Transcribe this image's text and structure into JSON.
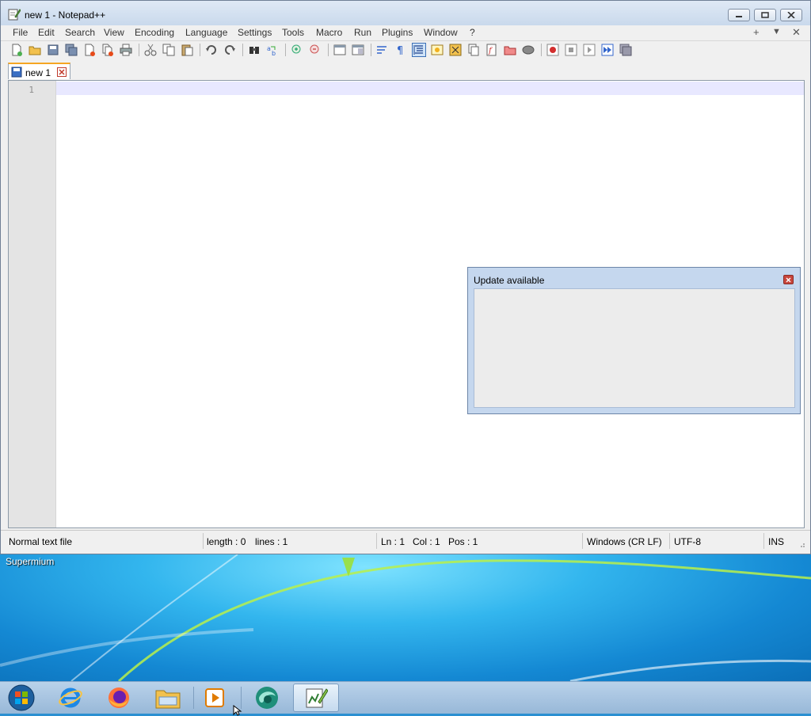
{
  "window": {
    "title": "new 1 - Notepad++"
  },
  "menu": {
    "items": [
      "File",
      "Edit",
      "Search",
      "View",
      "Encoding",
      "Language",
      "Settings",
      "Tools",
      "Macro",
      "Run",
      "Plugins",
      "Window",
      "?"
    ],
    "right_plus": "+",
    "right_down": "▼",
    "right_close": "✕"
  },
  "tabs": [
    {
      "label": "new 1"
    }
  ],
  "editor": {
    "line_number": "1"
  },
  "status": {
    "file_type": "Normal text file",
    "length": "length : 0",
    "lines": "lines : 1",
    "ln": "Ln : 1",
    "col": "Col : 1",
    "pos": "Pos : 1",
    "eol": "Windows (CR LF)",
    "encoding": "UTF-8",
    "mode": "INS"
  },
  "dialog": {
    "title": "Update available"
  },
  "desktop": {
    "label": "Supermium"
  },
  "taskbar": {
    "items": [
      "start-orb-icon",
      "internet-explorer-icon",
      "firefox-icon",
      "file-explorer-icon",
      "media-player-icon",
      "browser-icon",
      "notepadpp-icon"
    ]
  },
  "colors": {
    "accent_tab": "#f5a623",
    "current_line": "#e8e8ff",
    "dialog_frame": "#c5d7ee"
  }
}
